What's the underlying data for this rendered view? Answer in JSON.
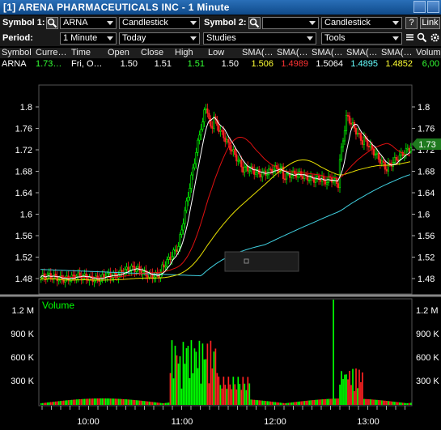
{
  "window": {
    "title": "[1] ARENA PHARMACEUTICALS INC - 1 Minute"
  },
  "toolbar1": {
    "symbol1_label": "Symbol 1:",
    "symbol1_value": "ARNA",
    "chart_type1": "Candlestick",
    "symbol2_label": "Symbol 2:",
    "symbol2_value": "",
    "chart_type2": "Candlestick",
    "help_label": "?",
    "link_label": "Link"
  },
  "toolbar2": {
    "period_label": "Period:",
    "period_value": "1 Minute",
    "range_value": "Today",
    "studies_value": "Studies",
    "tools_value": "Tools"
  },
  "quote": {
    "headers": [
      "Symbol",
      "Curre…",
      "Time",
      "Open",
      "Close",
      "High",
      "Low",
      "SMA(…",
      "SMA(…",
      "SMA(…",
      "SMA(…",
      "SMA(…",
      "Volum"
    ],
    "values": [
      "ARNA",
      "1.73…",
      "Fri, O…",
      "1.50",
      "1.51",
      "1.51",
      "1.50",
      "1.506",
      "1.4989",
      "1.5064",
      "1.4895",
      "1.4852",
      "6,00"
    ],
    "colors": [
      "#ffffff",
      "#33ff33",
      "#ffffff",
      "#ffffff",
      "#ffffff",
      "#33ff33",
      "#ffffff",
      "#ffff33",
      "#ff3333",
      "#ffffff",
      "#66ffff",
      "#ffff33",
      "#33ff33"
    ]
  },
  "price_axis": {
    "labels": [
      "1.8",
      "1.76",
      "1.72",
      "1.68",
      "1.64",
      "1.6",
      "1.56",
      "1.52",
      "1.48"
    ],
    "last_price": "1.73"
  },
  "volume_panel": {
    "title": "Volume",
    "labels": [
      "1.2 M",
      "900 K",
      "600 K",
      "300 K"
    ]
  },
  "time_axis": {
    "labels": [
      "10:00",
      "11:00",
      "12:00",
      "13:00"
    ]
  },
  "colors": {
    "up": "#00ff00",
    "down": "#ff2222",
    "sma_white": "#ffffff",
    "sma_red": "#e01010",
    "sma_yellow": "#e8e000",
    "sma_cyan": "#40d0e0"
  }
}
